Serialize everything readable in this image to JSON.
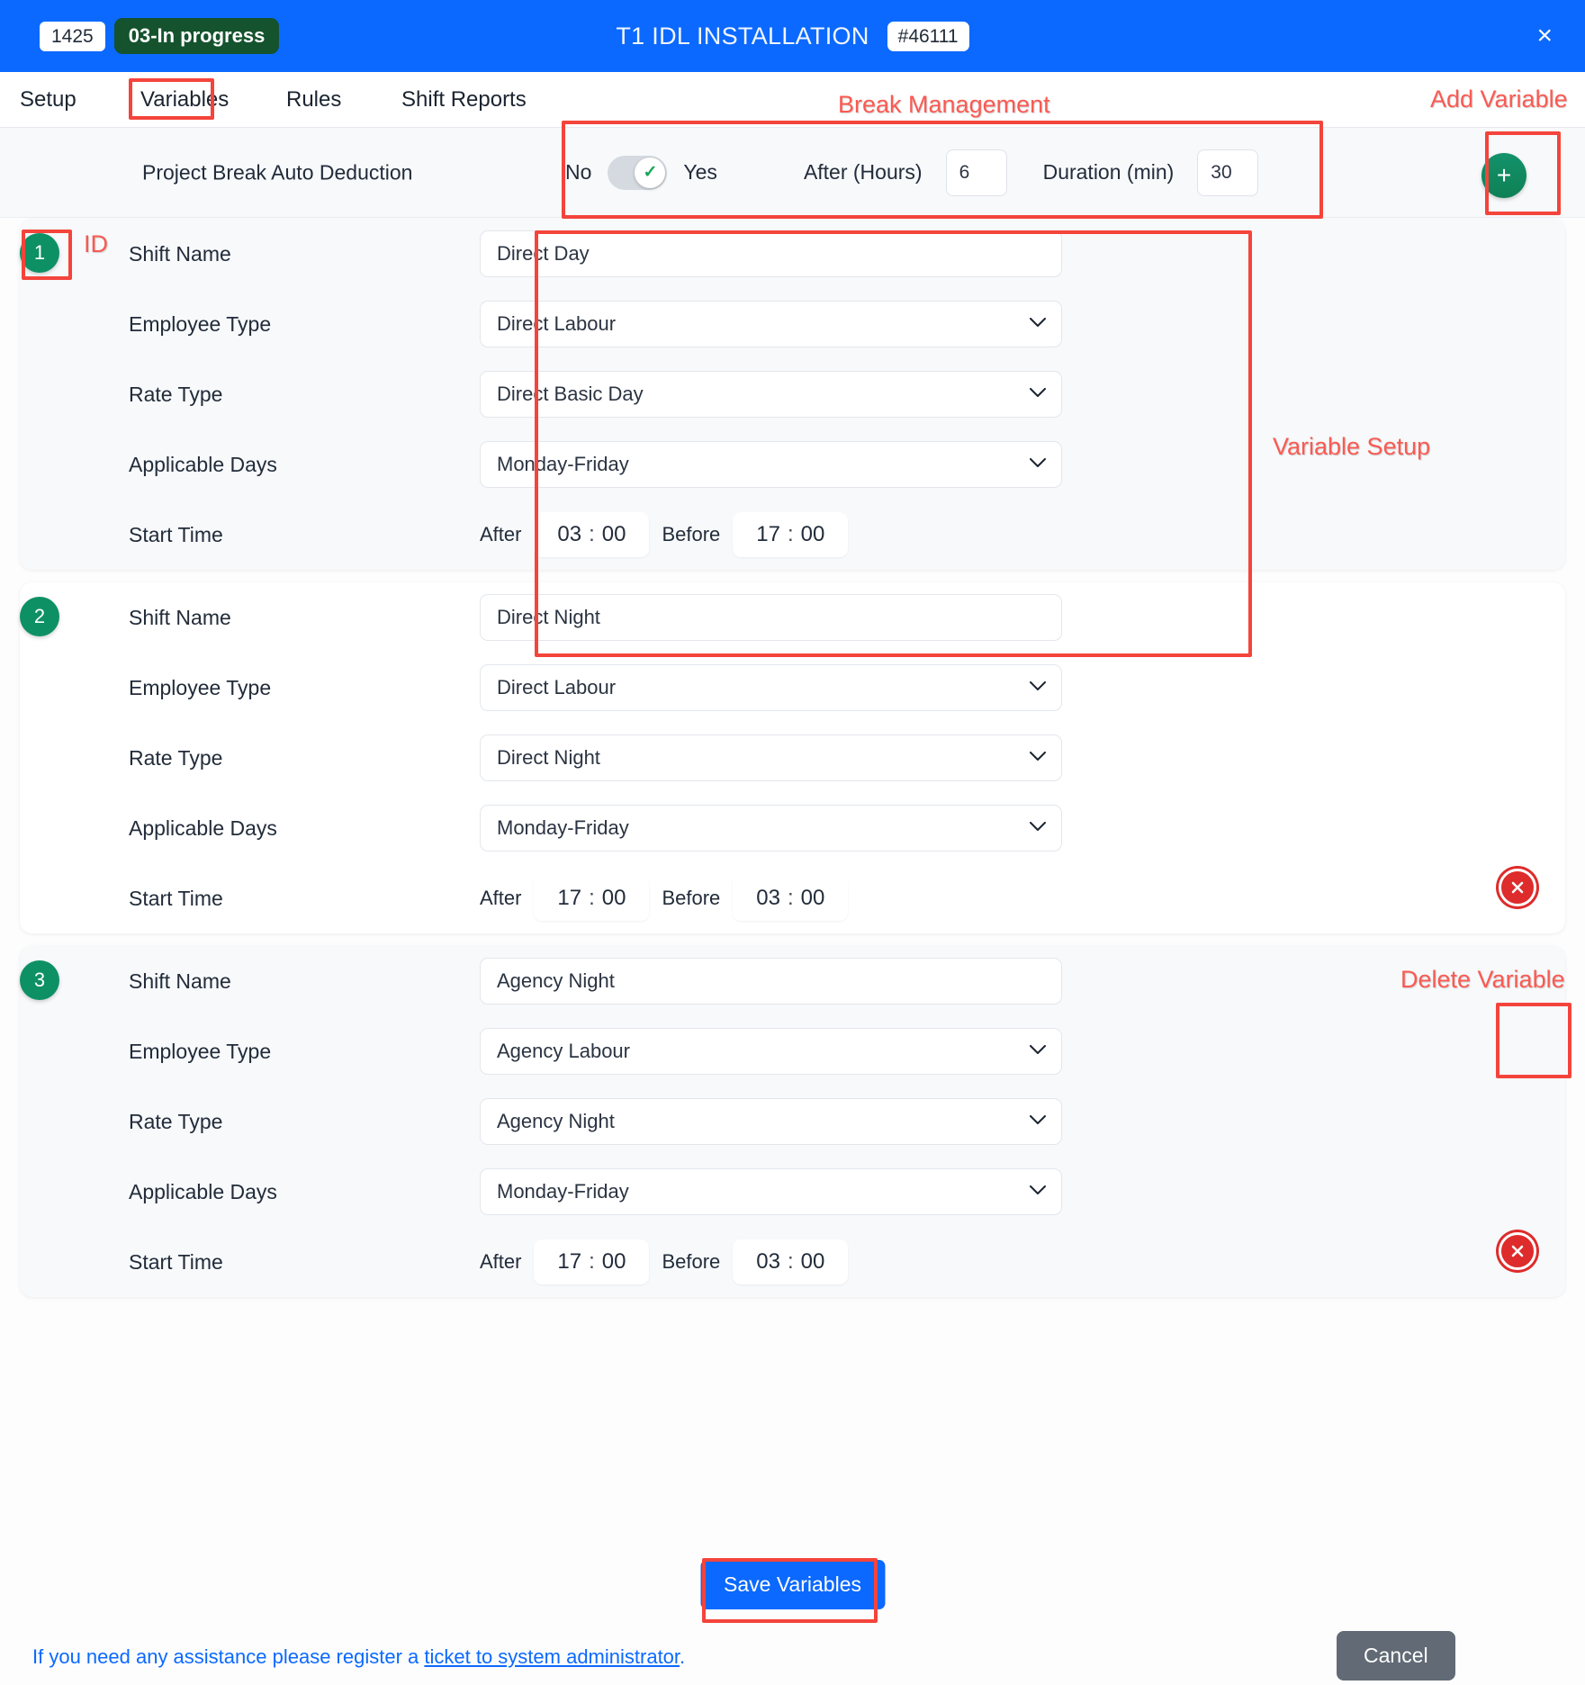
{
  "titlebar": {
    "id": "1425",
    "status": "03-In progress",
    "title": "T1 IDL INSTALLATION",
    "ticket": "#46111",
    "close": "×"
  },
  "tabs": [
    {
      "label": "Setup"
    },
    {
      "label": "Variables"
    },
    {
      "label": "Rules"
    },
    {
      "label": "Shift Reports"
    }
  ],
  "break_management": {
    "label": "Project Break Auto Deduction",
    "toggle_off_label": "No",
    "toggle_on_label": "Yes",
    "toggle_state": "on",
    "toggle_check_icon": "✓",
    "after_hours_label": "After (Hours)",
    "after_hours_value": "6",
    "duration_label": "Duration (min)",
    "duration_value": "30"
  },
  "add_variable_button": {
    "icon": "+",
    "icon_name": "plus-icon"
  },
  "field_labels": {
    "shift_name": "Shift Name",
    "employee_type": "Employee Type",
    "rate_type": "Rate Type",
    "applicable_days": "Applicable Days",
    "start_time": "Start Time",
    "after": "After",
    "before": "Before",
    "colon": ":"
  },
  "variables": [
    {
      "id": "1",
      "shift_name": "Direct Day",
      "employee_type": "Direct Labour",
      "rate_type": "Direct Basic Day",
      "applicable_days": "Monday-Friday",
      "after_hh": "03",
      "after_mm": "00",
      "before_hh": "17",
      "before_mm": "00",
      "has_delete": false
    },
    {
      "id": "2",
      "shift_name": "Direct Night",
      "employee_type": "Direct Labour",
      "rate_type": "Direct Night",
      "applicable_days": "Monday-Friday",
      "after_hh": "17",
      "after_mm": "00",
      "before_hh": "03",
      "before_mm": "00",
      "has_delete": true
    },
    {
      "id": "3",
      "shift_name": "Agency Night",
      "employee_type": "Agency Labour",
      "rate_type": "Agency Night",
      "applicable_days": "Monday-Friday",
      "after_hh": "17",
      "after_mm": "00",
      "before_hh": "03",
      "before_mm": "00",
      "has_delete": true
    }
  ],
  "footer": {
    "save_label": "Save Variables",
    "help_prefix": "If you need any assistance please register a ",
    "help_link": "ticket to system administrator",
    "help_suffix": ".",
    "cancel_label": "Cancel"
  },
  "annotations": {
    "break_management": "Break Management",
    "add_variable": "Add Variable",
    "id": "ID",
    "variable_setup": "Variable Setup",
    "delete_variable": "Delete Variable"
  },
  "colors": {
    "brand_blue": "#0b69ff",
    "status_green": "#14532d",
    "badge_green": "#0e9065",
    "delete_red": "#de2b2b",
    "annotation_red": "#fa5a52",
    "cancel_gray": "#616a75"
  }
}
